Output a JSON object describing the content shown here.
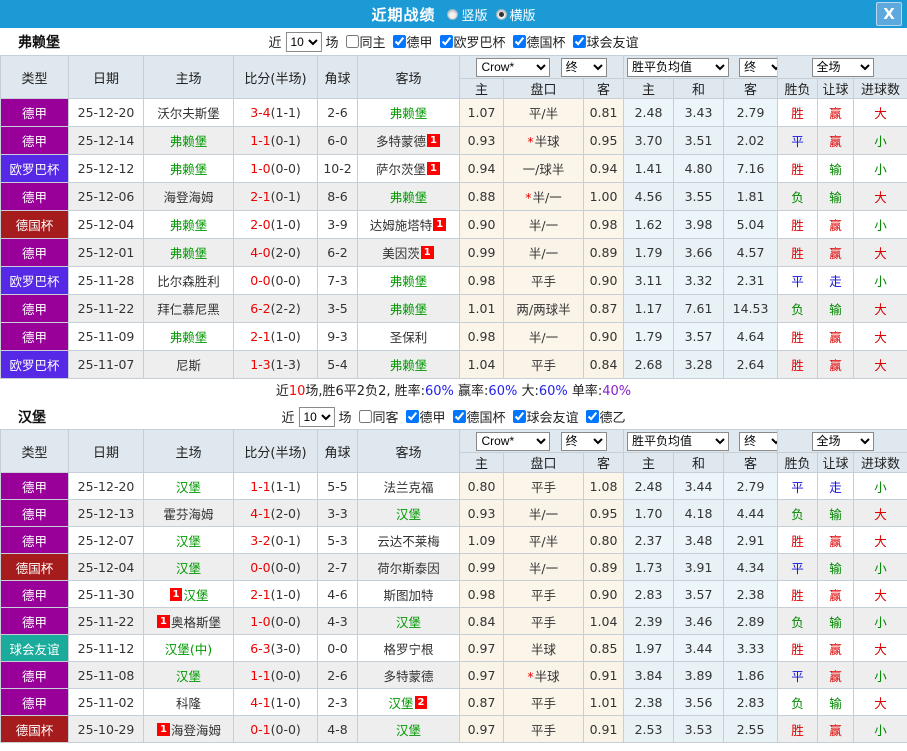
{
  "titlebar": {
    "title": "近期战绩",
    "vertical": "竖版",
    "horizontal": "横版",
    "close": "X"
  },
  "head": {
    "cols": [
      "类型",
      "日期",
      "主场",
      "比分(半场)",
      "角球",
      "客场"
    ],
    "sub": [
      "主",
      "盘口",
      "客",
      "主",
      "和",
      "客",
      "胜负",
      "让球",
      "进球数"
    ],
    "bookmaker": "Crow*",
    "final1": "终",
    "avg": "胜平负均值",
    "final2": "终",
    "full": "全场"
  },
  "league_colors": {
    "德甲": "#990099",
    "欧罗巴杯": "#5629e6",
    "德国杯": "#a61b1b",
    "球会友谊": "#1aab9b"
  },
  "result_colors": {
    "胜": "#dd0000",
    "赢": "#dd0000",
    "大": "#dd0000",
    "平": "#1111dd",
    "走": "#1111dd",
    "负": "#008800",
    "输": "#008800",
    "小": "#008800"
  },
  "summary_colors": {
    "k": "#222222",
    "r": "#ff0000",
    "b": "#2222ee",
    "p": "#8822cc"
  },
  "sections": [
    {
      "team": "弗赖堡",
      "filter": {
        "near": "近",
        "count": "10",
        "games": "场",
        "same": "同主",
        "same_checked": false,
        "leagues": [
          "德甲",
          "欧罗巴杯",
          "德国杯",
          "球会友谊"
        ]
      },
      "rows": [
        {
          "lg": "德甲",
          "date": "25-12-20",
          "home": "沃尔夫斯堡",
          "hg": false,
          "hb": "",
          "hbPos": "",
          "score": "3-4",
          "half": "(1-1)",
          "ck": "2-6",
          "away": "弗赖堡",
          "ag": true,
          "ab": "",
          "abPos": "",
          "o1": "1.07",
          "hc": "平/半",
          "star": false,
          "o2": "0.81",
          "e1": "2.48",
          "e2": "3.43",
          "e3": "2.79",
          "res": [
            "胜",
            "赢",
            "大"
          ]
        },
        {
          "lg": "德甲",
          "date": "25-12-14",
          "home": "弗赖堡",
          "hg": true,
          "hb": "",
          "hbPos": "",
          "score": "1-1",
          "half": "(0-1)",
          "ck": "6-0",
          "away": "多特蒙德",
          "ag": false,
          "ab": "1",
          "abPos": "post",
          "o1": "0.93",
          "hc": "半球",
          "star": true,
          "o2": "0.95",
          "e1": "3.70",
          "e2": "3.51",
          "e3": "2.02",
          "res": [
            "平",
            "赢",
            "小"
          ]
        },
        {
          "lg": "欧罗巴杯",
          "date": "25-12-12",
          "home": "弗赖堡",
          "hg": true,
          "hb": "",
          "hbPos": "",
          "score": "1-0",
          "half": "(0-0)",
          "ck": "10-2",
          "away": "萨尔茨堡",
          "ag": false,
          "ab": "1",
          "abPos": "post",
          "o1": "0.94",
          "hc": "一/球半",
          "star": false,
          "o2": "0.94",
          "e1": "1.41",
          "e2": "4.80",
          "e3": "7.16",
          "res": [
            "胜",
            "输",
            "小"
          ]
        },
        {
          "lg": "德甲",
          "date": "25-12-06",
          "home": "海登海姆",
          "hg": false,
          "hb": "",
          "hbPos": "",
          "score": "2-1",
          "half": "(0-1)",
          "ck": "8-6",
          "away": "弗赖堡",
          "ag": true,
          "ab": "",
          "abPos": "",
          "o1": "0.88",
          "hc": "半/一",
          "star": true,
          "o2": "1.00",
          "e1": "4.56",
          "e2": "3.55",
          "e3": "1.81",
          "res": [
            "负",
            "输",
            "大"
          ]
        },
        {
          "lg": "德国杯",
          "date": "25-12-04",
          "home": "弗赖堡",
          "hg": true,
          "hb": "",
          "hbPos": "",
          "score": "2-0",
          "half": "(1-0)",
          "ck": "3-9",
          "away": "达姆施塔特",
          "ag": false,
          "ab": "1",
          "abPos": "post",
          "o1": "0.90",
          "hc": "半/一",
          "star": false,
          "o2": "0.98",
          "e1": "1.62",
          "e2": "3.98",
          "e3": "5.04",
          "res": [
            "胜",
            "赢",
            "小"
          ]
        },
        {
          "lg": "德甲",
          "date": "25-12-01",
          "home": "弗赖堡",
          "hg": true,
          "hb": "",
          "hbPos": "",
          "score": "4-0",
          "half": "(2-0)",
          "ck": "6-2",
          "away": "美因茨",
          "ag": false,
          "ab": "1",
          "abPos": "post",
          "o1": "0.99",
          "hc": "半/一",
          "star": false,
          "o2": "0.89",
          "e1": "1.79",
          "e2": "3.66",
          "e3": "4.57",
          "res": [
            "胜",
            "赢",
            "大"
          ]
        },
        {
          "lg": "欧罗巴杯",
          "date": "25-11-28",
          "home": "比尔森胜利",
          "hg": false,
          "hb": "",
          "hbPos": "",
          "score": "0-0",
          "half": "(0-0)",
          "ck": "7-3",
          "away": "弗赖堡",
          "ag": true,
          "ab": "",
          "abPos": "",
          "o1": "0.98",
          "hc": "平手",
          "star": false,
          "o2": "0.90",
          "e1": "3.11",
          "e2": "3.32",
          "e3": "2.31",
          "res": [
            "平",
            "走",
            "小"
          ]
        },
        {
          "lg": "德甲",
          "date": "25-11-22",
          "home": "拜仁慕尼黑",
          "hg": false,
          "hb": "",
          "hbPos": "",
          "score": "6-2",
          "half": "(2-2)",
          "ck": "3-5",
          "away": "弗赖堡",
          "ag": true,
          "ab": "",
          "abPos": "",
          "o1": "1.01",
          "hc": "两/两球半",
          "star": false,
          "o2": "0.87",
          "e1": "1.17",
          "e2": "7.61",
          "e3": "14.53",
          "res": [
            "负",
            "输",
            "大"
          ]
        },
        {
          "lg": "德甲",
          "date": "25-11-09",
          "home": "弗赖堡",
          "hg": true,
          "hb": "",
          "hbPos": "",
          "score": "2-1",
          "half": "(1-0)",
          "ck": "9-3",
          "away": "圣保利",
          "ag": false,
          "ab": "",
          "abPos": "",
          "o1": "0.98",
          "hc": "半/一",
          "star": false,
          "o2": "0.90",
          "e1": "1.79",
          "e2": "3.57",
          "e3": "4.64",
          "res": [
            "胜",
            "赢",
            "大"
          ]
        },
        {
          "lg": "欧罗巴杯",
          "date": "25-11-07",
          "home": "尼斯",
          "hg": false,
          "hb": "",
          "hbPos": "",
          "score": "1-3",
          "half": "(1-3)",
          "ck": "5-4",
          "away": "弗赖堡",
          "ag": true,
          "ab": "",
          "abPos": "",
          "o1": "1.04",
          "hc": "平手",
          "star": false,
          "o2": "0.84",
          "e1": "2.68",
          "e2": "3.28",
          "e3": "2.64",
          "res": [
            "胜",
            "赢",
            "大"
          ]
        }
      ],
      "summary": [
        {
          "t": "近",
          "c": "k"
        },
        {
          "t": "10",
          "c": "r"
        },
        {
          "t": "场,胜6平2负2, ",
          "c": "k"
        },
        {
          "t": "胜率:",
          "c": "k"
        },
        {
          "t": "60%",
          "c": "b"
        },
        {
          "t": " 赢率:",
          "c": "k"
        },
        {
          "t": "60%",
          "c": "b"
        },
        {
          "t": " 大:",
          "c": "k"
        },
        {
          "t": "60%",
          "c": "b"
        },
        {
          "t": " 单率:",
          "c": "k"
        },
        {
          "t": "40%",
          "c": "p"
        }
      ]
    },
    {
      "team": "汉堡",
      "filter": {
        "near": "近",
        "count": "10",
        "games": "场",
        "same": "同客",
        "same_checked": false,
        "leagues": [
          "德甲",
          "德国杯",
          "球会友谊",
          "德乙"
        ]
      },
      "rows": [
        {
          "lg": "德甲",
          "date": "25-12-20",
          "home": "汉堡",
          "hg": true,
          "hb": "",
          "hbPos": "",
          "score": "1-1",
          "half": "(1-1)",
          "ck": "5-5",
          "away": "法兰克福",
          "ag": false,
          "ab": "",
          "abPos": "",
          "o1": "0.80",
          "hc": "平手",
          "star": false,
          "o2": "1.08",
          "e1": "2.48",
          "e2": "3.44",
          "e3": "2.79",
          "res": [
            "平",
            "走",
            "小"
          ]
        },
        {
          "lg": "德甲",
          "date": "25-12-13",
          "home": "霍芬海姆",
          "hg": false,
          "hb": "",
          "hbPos": "",
          "score": "4-1",
          "half": "(2-0)",
          "ck": "3-3",
          "away": "汉堡",
          "ag": true,
          "ab": "",
          "abPos": "",
          "o1": "0.93",
          "hc": "半/一",
          "star": false,
          "o2": "0.95",
          "e1": "1.70",
          "e2": "4.18",
          "e3": "4.44",
          "res": [
            "负",
            "输",
            "大"
          ]
        },
        {
          "lg": "德甲",
          "date": "25-12-07",
          "home": "汉堡",
          "hg": true,
          "hb": "",
          "hbPos": "",
          "score": "3-2",
          "half": "(0-1)",
          "ck": "5-3",
          "away": "云达不莱梅",
          "ag": false,
          "ab": "",
          "abPos": "",
          "o1": "1.09",
          "hc": "平/半",
          "star": false,
          "o2": "0.80",
          "e1": "2.37",
          "e2": "3.48",
          "e3": "2.91",
          "res": [
            "胜",
            "赢",
            "大"
          ]
        },
        {
          "lg": "德国杯",
          "date": "25-12-04",
          "home": "汉堡",
          "hg": true,
          "hb": "",
          "hbPos": "",
          "score": "0-0",
          "half": "(0-0)",
          "ck": "2-7",
          "away": "荷尔斯泰因",
          "ag": false,
          "ab": "",
          "abPos": "",
          "o1": "0.99",
          "hc": "半/一",
          "star": false,
          "o2": "0.89",
          "e1": "1.73",
          "e2": "3.91",
          "e3": "4.34",
          "res": [
            "平",
            "输",
            "小"
          ]
        },
        {
          "lg": "德甲",
          "date": "25-11-30",
          "home": "汉堡",
          "hg": true,
          "hb": "1",
          "hbPos": "pre",
          "score": "2-1",
          "half": "(1-0)",
          "ck": "4-6",
          "away": "斯图加特",
          "ag": false,
          "ab": "",
          "abPos": "",
          "o1": "0.98",
          "hc": "平手",
          "star": false,
          "o2": "0.90",
          "e1": "2.83",
          "e2": "3.57",
          "e3": "2.38",
          "res": [
            "胜",
            "赢",
            "大"
          ]
        },
        {
          "lg": "德甲",
          "date": "25-11-22",
          "home": "奥格斯堡",
          "hg": false,
          "hb": "1",
          "hbPos": "pre",
          "score": "1-0",
          "half": "(0-0)",
          "ck": "4-3",
          "away": "汉堡",
          "ag": true,
          "ab": "",
          "abPos": "",
          "o1": "0.84",
          "hc": "平手",
          "star": false,
          "o2": "1.04",
          "e1": "2.39",
          "e2": "3.46",
          "e3": "2.89",
          "res": [
            "负",
            "输",
            "小"
          ]
        },
        {
          "lg": "球会友谊",
          "date": "25-11-12",
          "home": "汉堡(中)",
          "hg": true,
          "hb": "",
          "hbPos": "",
          "score": "6-3",
          "half": "(3-0)",
          "ck": "0-0",
          "away": "格罗宁根",
          "ag": false,
          "ab": "",
          "abPos": "",
          "o1": "0.97",
          "hc": "半球",
          "star": false,
          "o2": "0.85",
          "e1": "1.97",
          "e2": "3.44",
          "e3": "3.33",
          "res": [
            "胜",
            "赢",
            "大"
          ]
        },
        {
          "lg": "德甲",
          "date": "25-11-08",
          "home": "汉堡",
          "hg": true,
          "hb": "",
          "hbPos": "",
          "score": "1-1",
          "half": "(0-0)",
          "ck": "2-6",
          "away": "多特蒙德",
          "ag": false,
          "ab": "",
          "abPos": "",
          "o1": "0.97",
          "hc": "半球",
          "star": true,
          "o2": "0.91",
          "e1": "3.84",
          "e2": "3.89",
          "e3": "1.86",
          "res": [
            "平",
            "赢",
            "小"
          ]
        },
        {
          "lg": "德甲",
          "date": "25-11-02",
          "home": "科隆",
          "hg": false,
          "hb": "",
          "hbPos": "",
          "score": "4-1",
          "half": "(1-0)",
          "ck": "2-3",
          "away": "汉堡",
          "ag": true,
          "ab": "2",
          "abPos": "post",
          "o1": "0.87",
          "hc": "平手",
          "star": false,
          "o2": "1.01",
          "e1": "2.38",
          "e2": "3.56",
          "e3": "2.83",
          "res": [
            "负",
            "输",
            "大"
          ]
        },
        {
          "lg": "德国杯",
          "date": "25-10-29",
          "home": "海登海姆",
          "hg": false,
          "hb": "1",
          "hbPos": "pre",
          "score": "0-1",
          "half": "(0-0)",
          "ck": "4-8",
          "away": "汉堡",
          "ag": true,
          "ab": "",
          "abPos": "",
          "o1": "0.97",
          "hc": "平手",
          "star": false,
          "o2": "0.91",
          "e1": "2.53",
          "e2": "3.53",
          "e3": "2.55",
          "res": [
            "胜",
            "赢",
            "小"
          ]
        }
      ]
    }
  ]
}
